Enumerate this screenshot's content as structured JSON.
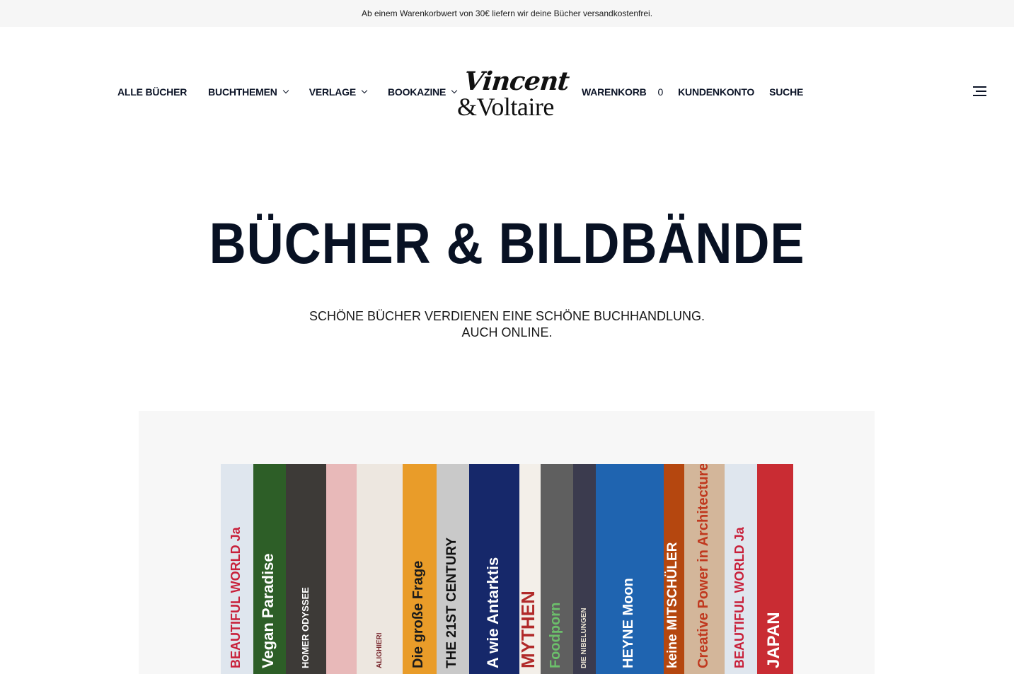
{
  "announcement": "Ab einem Warenkorbwert von 30€ liefern wir deine Bücher versandkostenfrei.",
  "nav_left": [
    {
      "label": "ALLE BÜCHER",
      "has_dropdown": false
    },
    {
      "label": "BUCHTHEMEN",
      "has_dropdown": true
    },
    {
      "label": "VERLAGE",
      "has_dropdown": true
    },
    {
      "label": "BOOKAZINE",
      "has_dropdown": true
    }
  ],
  "logo": {
    "line1": "Vincent",
    "line2": "&Voltaire"
  },
  "nav_right": {
    "cart_label": "WARENKORB",
    "cart_count": "0",
    "account_label": "KUNDENKONTO",
    "search_label": "SUCHE"
  },
  "menu_icon": "hamburger-icon",
  "hero": {
    "title": "BÜCHER & BILDBÄNDE",
    "subtitle_line1": "SCHÖNE BÜCHER VERDIENEN EINE SCHÖNE BUCHHANDLUNG.",
    "subtitle_line2": "AUCH ONLINE."
  },
  "books": [
    {
      "title": "BEAUTIFUL WORLD Ja",
      "color": "#dfe6ee",
      "text_color": "#c8203a"
    },
    {
      "title": "Vegan Paradise",
      "color": "#2d5e27",
      "text_color": "#ffffff"
    },
    {
      "title": "HOMER ODYSSEE",
      "color": "#3d3a37",
      "text_color": "#ffffff"
    },
    {
      "title": "",
      "color": "#e8b9b9",
      "text_color": "#ffffff"
    },
    {
      "title": "ALIGHIERI",
      "color": "#ede7e0",
      "text_color": "#7a2a30"
    },
    {
      "title": "Die große Frage",
      "color": "#e99c29",
      "text_color": "#1b1b1b"
    },
    {
      "title": "THE 21ST CENTURY",
      "color": "#c9c9c9",
      "text_color": "#111111"
    },
    {
      "title": "A wie Antarktis",
      "color": "#16286a",
      "text_color": "#ffffff"
    },
    {
      "title": "MYTHEN",
      "color": "#f3efe9",
      "text_color": "#b12a2a"
    },
    {
      "title": "Foodporn",
      "color": "#5f5f5f",
      "text_color": "#6cbf6b"
    },
    {
      "title": "DIE NIBELUNGEN",
      "color": "#3b3b4e",
      "text_color": "#e9e2d2"
    },
    {
      "title": "HEYNE Moon",
      "color": "#1f64b0",
      "text_color": "#ffffff"
    },
    {
      "title": "keine MITSCHÜLER",
      "color": "#b5470f",
      "text_color": "#ffffff"
    },
    {
      "title": "Creative Power in Architecture",
      "color": "#d3b69a",
      "text_color": "#c0391f"
    },
    {
      "title": "BEAUTIFUL WORLD Ja",
      "color": "#dfe6ee",
      "text_color": "#c8203a"
    },
    {
      "title": "JAPAN",
      "color": "#c92c33",
      "text_color": "#ffffff"
    }
  ]
}
